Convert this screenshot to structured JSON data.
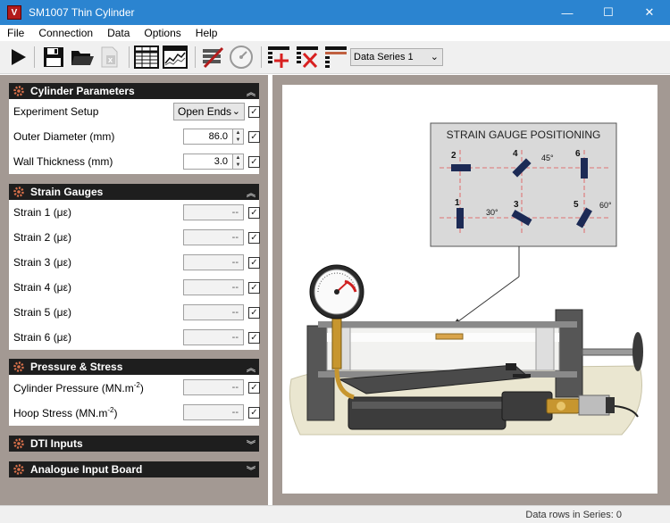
{
  "window": {
    "title": "SM1007 Thin Cylinder",
    "app_icon_glyph": "V",
    "controls": {
      "minimize": "—",
      "maximize": "☐",
      "close": "✕"
    }
  },
  "menu": [
    "File",
    "Connection",
    "Data",
    "Options",
    "Help"
  ],
  "toolbar": {
    "buttons": [
      "play-icon",
      "save-icon",
      "open-folder-icon",
      "excel-export-icon",
      "table-view-icon",
      "chart-view-icon",
      "calibrate-icon",
      "gauge-icon",
      "add-series-icon",
      "delete-series-icon",
      "series-table-icon"
    ],
    "series_select": "Data Series 1"
  },
  "sections": {
    "cylinder": {
      "title": "Cylinder Parameters",
      "rows": [
        {
          "label": "Experiment Setup",
          "value": "Open Ends"
        },
        {
          "label": "Outer Diameter  (mm)",
          "value": "86.0"
        },
        {
          "label": "Wall Thickness  (mm)",
          "value": "3.0"
        }
      ]
    },
    "strain": {
      "title": "Strain Gauges",
      "rows": [
        {
          "label": "Strain 1  (με)",
          "value": "--"
        },
        {
          "label": "Strain 2  (με)",
          "value": "--"
        },
        {
          "label": "Strain 3  (με)",
          "value": "--"
        },
        {
          "label": "Strain 4  (με)",
          "value": "--"
        },
        {
          "label": "Strain 5  (με)",
          "value": "--"
        },
        {
          "label": "Strain 6  (με)",
          "value": "--"
        }
      ]
    },
    "pressure": {
      "title": "Pressure & Stress",
      "rows": [
        {
          "label": "Cylinder Pressure  (MN.m",
          "sup": "-2",
          "tail": ")",
          "value": "--"
        },
        {
          "label": "Hoop Stress  (MN.m",
          "sup": "-2",
          "tail": ")",
          "value": "--"
        }
      ]
    },
    "dti": {
      "title": "DTI Inputs"
    },
    "analogue": {
      "title": "Analogue Input Board"
    }
  },
  "diagram": {
    "title": "STRAIN GAUGE POSITIONING",
    "gauges": [
      "1",
      "2",
      "3",
      "4",
      "5",
      "6"
    ],
    "angles": [
      "45°",
      "30°",
      "60°"
    ]
  },
  "status": "Data rows in Series: 0",
  "colors": {
    "titlebar": "#2b84d0",
    "panel_bg": "#a39993",
    "section_header": "#1e1e1e",
    "accent_red": "#b21b1b"
  }
}
